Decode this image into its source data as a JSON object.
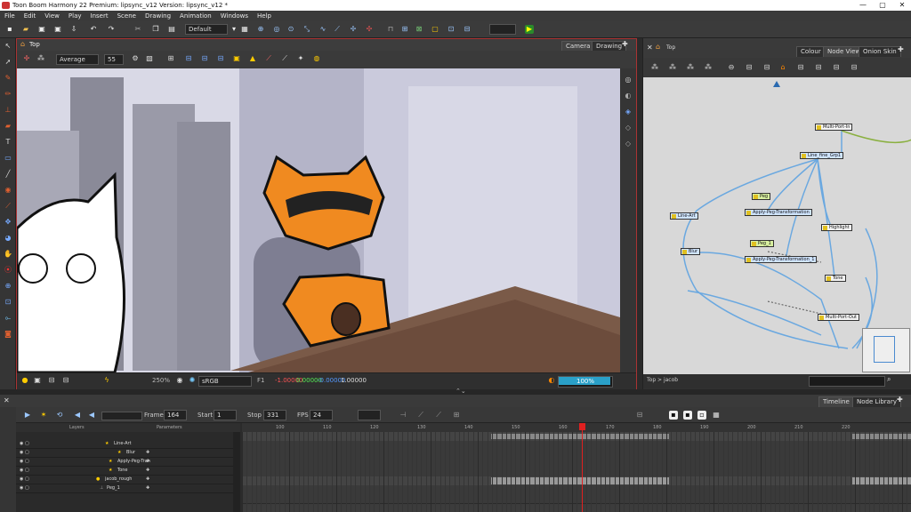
{
  "app": {
    "title": "Toon Boom Harmony 22 Premium: lipsync_v12 Version: lipsync_v12 *",
    "window_controls": [
      "—",
      "▢",
      "✕"
    ]
  },
  "menu": [
    "File",
    "Edit",
    "View",
    "Play",
    "Insert",
    "Scene",
    "Drawing",
    "Animation",
    "Windows",
    "Help"
  ],
  "toolbar": {
    "workspace": "Default"
  },
  "camera_view": {
    "breadcrumb": "Top",
    "tabs": [
      "Camera",
      "Drawing"
    ],
    "brush_mode": "Average",
    "brush_size": "55",
    "footer": {
      "zoom": "250%",
      "color_space": "sRGB",
      "frame_label": "F1",
      "coord_x": "-1.00000",
      "coord_y": "0.00000",
      "coord_z": "-0.00000",
      "scale": "1.00000",
      "progress": "100%"
    }
  },
  "node_view": {
    "breadcrumb": "Top",
    "tabs": [
      "Colour",
      "Node View",
      "Onion Skin"
    ],
    "path": "Top > jacob",
    "nodes": [
      "Multi-Port-In",
      "Line_fine_Grp1",
      "Line-Art",
      "Peg",
      "Apply-Peg-Transformation",
      "Highlight",
      "Blur",
      "Peg_1",
      "Apply-Peg-Transformation_1",
      "Tone",
      "Multi-Port-Out"
    ]
  },
  "timeline": {
    "tabs": [
      "Timeline",
      "Node Library"
    ],
    "frame_label": "Frame",
    "frame": "164",
    "start_label": "Start",
    "start": "1",
    "stop_label": "Stop",
    "stop": "331",
    "fps_label": "FPS",
    "fps": "24",
    "layers_header": "Layers",
    "params_header": "Parameters",
    "layers": [
      "Line-Art",
      "Blur",
      "Apply-Peg-Tran",
      "Tone",
      "jacob_rough",
      "Peg_1"
    ],
    "ruler": [
      "100",
      "110",
      "120",
      "130",
      "140",
      "150",
      "160",
      "170",
      "180",
      "190",
      "200",
      "210",
      "220"
    ]
  }
}
